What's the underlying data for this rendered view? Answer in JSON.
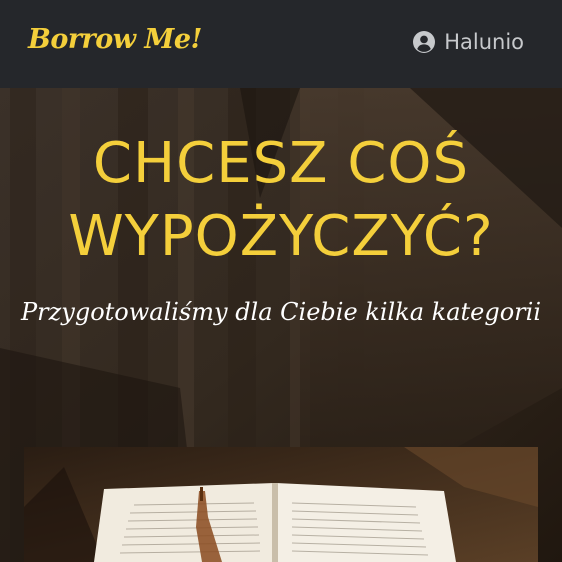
{
  "navbar": {
    "brand": "Borrow Me!",
    "user_icon": "user-circle-icon",
    "username": "Halunio"
  },
  "hero": {
    "title_line1": "CHCESZ COŚ",
    "title_line2": "WYPOŻYCZYĆ?",
    "subtitle": "Przygotowaliśmy dla Ciebie kilka kategorii",
    "background": "wooden-stairs-photo"
  },
  "category_card": {
    "image": "open-book-photo"
  },
  "colors": {
    "accent": "#f4cf3b",
    "navbar_bg": "#25272b",
    "nav_text": "#c7c9cc"
  }
}
